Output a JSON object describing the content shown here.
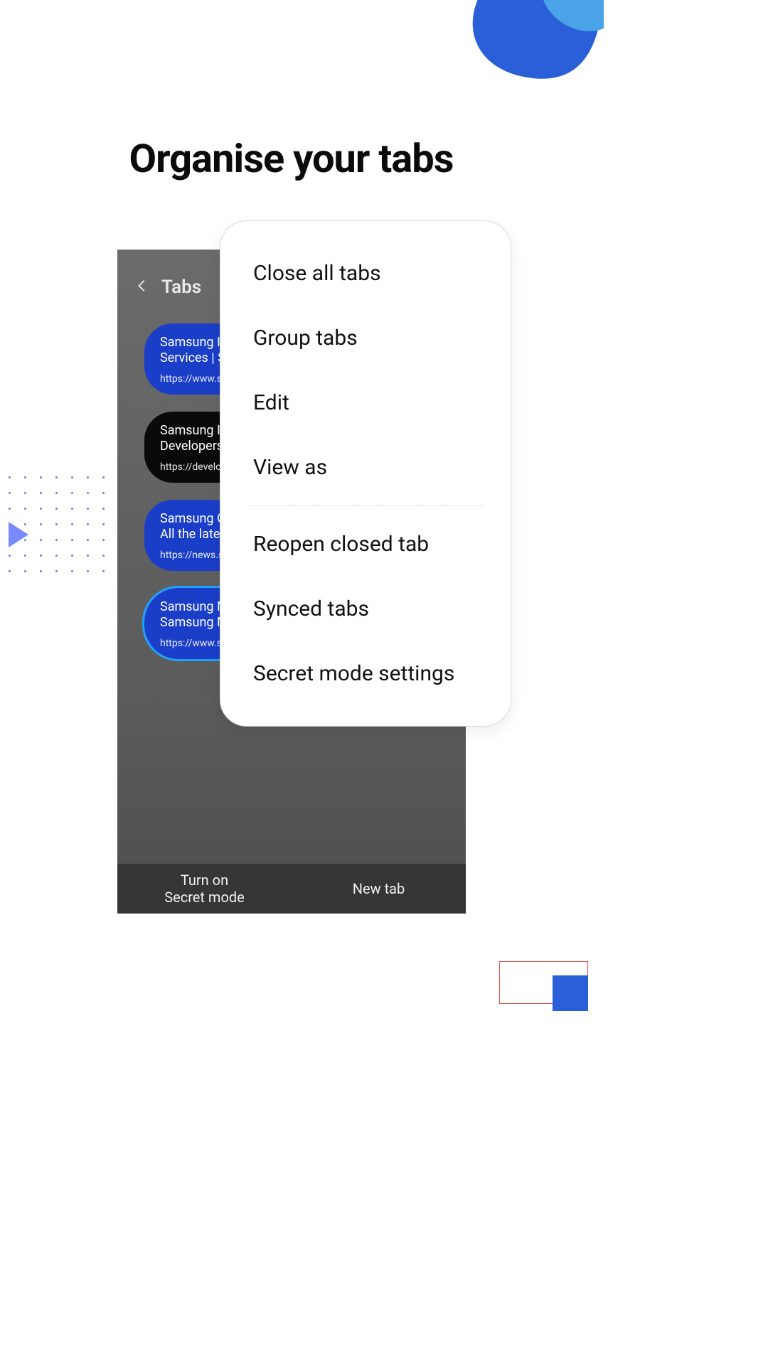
{
  "heading": "Organise your tabs",
  "phone": {
    "title": "Tabs",
    "tabs": [
      {
        "line1": "Samsung Inter",
        "line2": "Services | Sams",
        "url": "https://www.samsu",
        "style": "blue"
      },
      {
        "line1": "Samsung Inter",
        "line2": "Developers",
        "url": "https://developer.sa",
        "style": "black"
      },
      {
        "line1": "Samsung Globa",
        "line2": "All the latest n",
        "url": "https://news.samsu",
        "style": "blue"
      },
      {
        "line1": "Samsung Mobi",
        "line2": "Samsung Mobi",
        "url": "https://www.samsu",
        "style": "blue",
        "outlined": true
      }
    ],
    "bottom": {
      "secret_line1": "Turn on",
      "secret_line2": "Secret mode",
      "newtab": "New tab"
    }
  },
  "menu": {
    "items_top": [
      "Close all tabs",
      "Group tabs",
      "Edit",
      "View as"
    ],
    "items_bottom": [
      "Reopen closed tab",
      "Synced tabs",
      "Secret mode settings"
    ]
  }
}
